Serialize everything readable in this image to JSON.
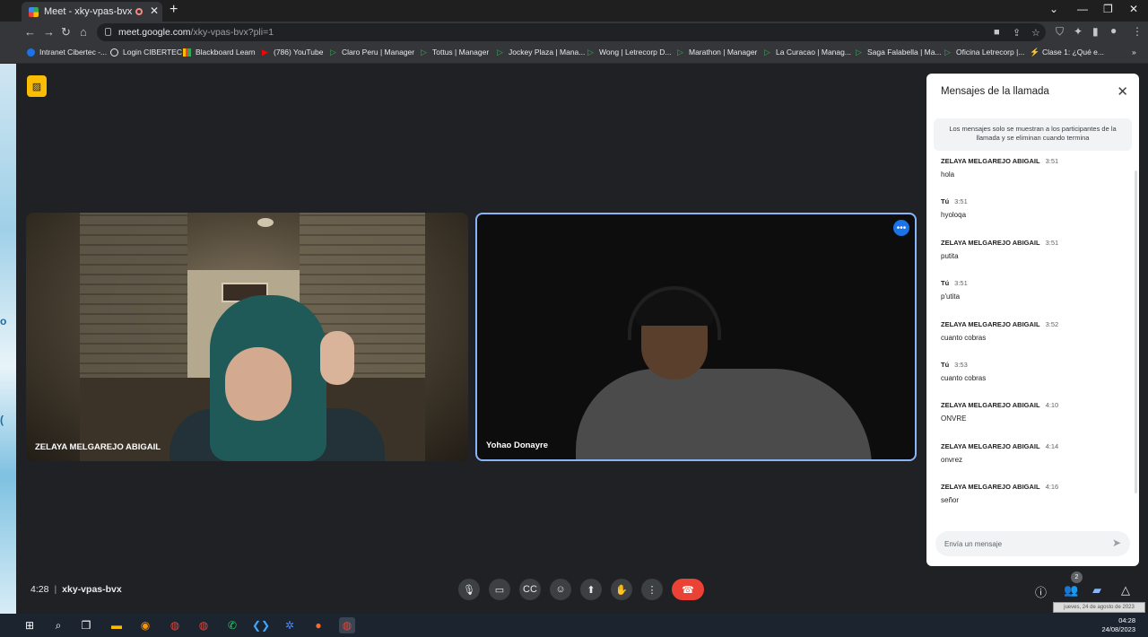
{
  "browser": {
    "tab_title": "Meet - xky-vpas-bvx",
    "new_tab_glyph": "+",
    "url_host": "meet.google.com",
    "url_path": "/xky-vpas-bvx?pli=1"
  },
  "bookmarks": [
    {
      "label": "Intranet Cibertec -...",
      "icon": "dot"
    },
    {
      "label": "Login CIBERTEC",
      "icon": "circ"
    },
    {
      "label": "Blackboard Learn",
      "icon": "bar"
    },
    {
      "label": "(786) YouTube",
      "icon": "yt"
    },
    {
      "label": "Claro Peru | Manager",
      "icon": "gtri"
    },
    {
      "label": "Tottus | Manager",
      "icon": "gtri"
    },
    {
      "label": "Jockey Plaza | Mana...",
      "icon": "gtri"
    },
    {
      "label": "Wong | Letrecorp D...",
      "icon": "gtri"
    },
    {
      "label": "Marathon | Manager",
      "icon": "gtri"
    },
    {
      "label": "La Curacao | Manag...",
      "icon": "gtri"
    },
    {
      "label": "Saga Falabella | Ma...",
      "icon": "gtri"
    },
    {
      "label": "Oficina Letrecorp |...",
      "icon": "gtri"
    },
    {
      "label": "Clase 1: ¿Qué e...",
      "icon": "rocket"
    }
  ],
  "participants": [
    {
      "name": "ZELAYA MELGAREJO ABIGAIL"
    },
    {
      "name": "Yohao Donayre"
    }
  ],
  "chat": {
    "title": "Mensajes de la llamada",
    "notice": "Los mensajes solo se muestran a los participantes de la llamada y se eliminan cuando termina",
    "messages": [
      {
        "sender": "ZELAYA MELGAREJO ABIGAIL",
        "time": "3:51",
        "text": "hola"
      },
      {
        "sender": "Tú",
        "time": "3:51",
        "text": "hyoloqa"
      },
      {
        "sender": "ZELAYA MELGAREJO ABIGAIL",
        "time": "3:51",
        "text": "putita"
      },
      {
        "sender": "Tú",
        "time": "3:51",
        "text": "p'utita"
      },
      {
        "sender": "ZELAYA MELGAREJO ABIGAIL",
        "time": "3:52",
        "text": "cuanto cobras"
      },
      {
        "sender": "Tú",
        "time": "3:53",
        "text": "cuanto cobras"
      },
      {
        "sender": "ZELAYA MELGAREJO ABIGAIL",
        "time": "4:10",
        "text": "ONVRE"
      },
      {
        "sender": "ZELAYA MELGAREJO ABIGAIL",
        "time": "4:14",
        "text": "onvrez"
      },
      {
        "sender": "ZELAYA MELGAREJO ABIGAIL",
        "time": "4:16",
        "text": "señor"
      }
    ],
    "input_placeholder": "Envía un mensaje"
  },
  "meeting": {
    "time": "4:28",
    "separator": "|",
    "code": "xky-vpas-bvx",
    "people_count": "2"
  },
  "taskbar": {
    "time": "04:28",
    "date": "24/08/2023",
    "tooltip": "jueves, 24 de agosto de 2023"
  },
  "colors": {
    "background": "#202124",
    "active_tile_border": "#8ab4f8",
    "end_call": "#ea4335",
    "camera_off_badge": "#fbbc04"
  }
}
